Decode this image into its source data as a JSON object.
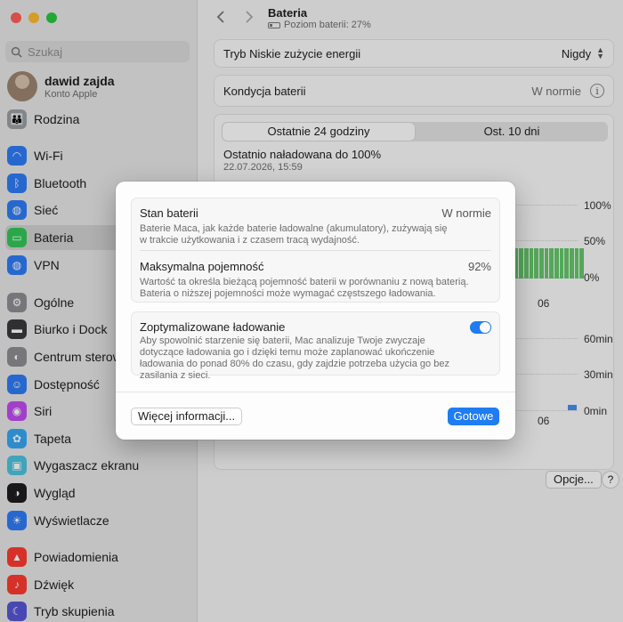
{
  "sidebar": {
    "search_placeholder": "Szukaj",
    "account": {
      "name": "dawid zajda",
      "subtitle": "Konto Apple"
    },
    "items": [
      {
        "label": "Rodzina",
        "icon": "family-icon",
        "color": "#9aa0a6"
      },
      {
        "label": "Wi‑Fi",
        "icon": "wifi-icon",
        "color": "#2f7df6"
      },
      {
        "label": "Bluetooth",
        "icon": "bluetooth-icon",
        "color": "#2f7df6"
      },
      {
        "label": "Sieć",
        "icon": "globe-icon",
        "color": "#2f7df6"
      },
      {
        "label": "Bateria",
        "icon": "battery-icon",
        "color": "#34c759"
      },
      {
        "label": "VPN",
        "icon": "vpn-globe-icon",
        "color": "#2f7df6"
      },
      {
        "label": "Ogólne",
        "icon": "gear-icon",
        "color": "#8e8e93"
      },
      {
        "label": "Biurko i Dock",
        "icon": "dock-icon",
        "color": "#3a3a3c"
      },
      {
        "label": "Centrum sterowania",
        "icon": "control-center-icon",
        "color": "#8e8e93"
      },
      {
        "label": "Dostępność",
        "icon": "accessibility-icon",
        "color": "#2f7df6"
      },
      {
        "label": "Siri",
        "icon": "siri-icon",
        "color": "#c04cf0"
      },
      {
        "label": "Tapeta",
        "icon": "wallpaper-icon",
        "color": "#37a7f5"
      },
      {
        "label": "Wygaszacz ekranu",
        "icon": "screensaver-icon",
        "color": "#4ec3e0"
      },
      {
        "label": "Wygląd",
        "icon": "appearance-icon",
        "color": "#1d1d1f"
      },
      {
        "label": "Wyświetlacze",
        "icon": "display-icon",
        "color": "#2f7df6"
      },
      {
        "label": "Powiadomienia",
        "icon": "bell-icon",
        "color": "#ff3b30"
      },
      {
        "label": "Dźwięk",
        "icon": "speaker-icon",
        "color": "#ff3b30"
      },
      {
        "label": "Tryb skupienia",
        "icon": "moon-icon",
        "color": "#5856d6"
      }
    ]
  },
  "header": {
    "title": "Bateria",
    "subtitle": "Poziom baterii: 27%"
  },
  "main": {
    "low_power": {
      "label": "Tryb Niskie zużycie energii",
      "value": "Nigdy"
    },
    "health": {
      "label": "Kondycja baterii",
      "value": "W normie"
    },
    "tabs": [
      "Ostatnie 24 godziny",
      "Ost. 10 dni"
    ],
    "last_charged": {
      "label": "Ostatnio naładowana do 100%",
      "date": "22.07.2026, 15:59"
    },
    "axis_level": [
      "100%",
      "50%",
      "0%"
    ],
    "axis_time": [
      "60min",
      "30min",
      "0min"
    ],
    "axis_x": "06",
    "options_label": "Opcje...",
    "help_label": "?"
  },
  "dialog": {
    "health": {
      "title": "Stan baterii",
      "value": "W normie",
      "desc": "Baterie Maca, jak każde baterie ładowalne (akumulatory), zużywają się w trakcie użytkowania i z czasem tracą wydajność."
    },
    "capacity": {
      "title": "Maksymalna pojemność",
      "value": "92%",
      "desc": "Wartość ta określa bieżącą pojemność baterii w porównaniu z nową baterią. Bateria o niższej pojemności może wymagać częstszego ładowania."
    },
    "optimized": {
      "title": "Zoptymalizowane ładowanie",
      "enabled": true,
      "desc": "Aby spowolnić starzenie się baterii, Mac analizuje Twoje zwyczaje dotyczące ładowania go i dzięki temu może zaplanować ukończenie ładowania do ponad 80% do czasu, gdy zajdzie potrzeba użycia go bez zasilania z sieci."
    },
    "more_info": "Więcej informacji...",
    "done": "Gotowe"
  }
}
